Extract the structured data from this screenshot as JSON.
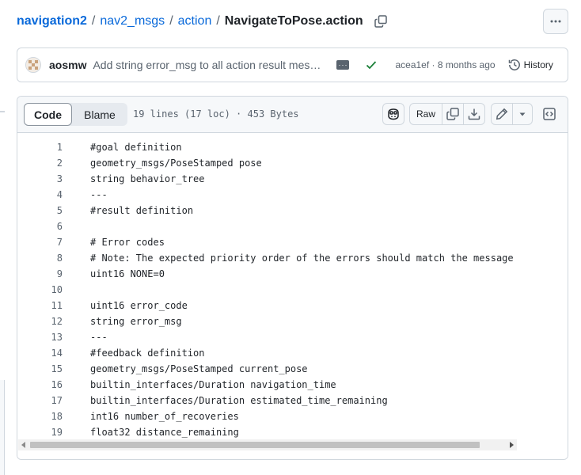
{
  "breadcrumb": {
    "repo": "navigation2",
    "folder1": "nav2_msgs",
    "folder2": "action",
    "file": "NavigateToPose.action",
    "separator": "/"
  },
  "commit": {
    "author": "aosmw",
    "message": "Add string error_msg to all action result messages",
    "sha": "acea1ef",
    "age": "8 months ago",
    "dot": "·",
    "history_label": "History",
    "status": "success",
    "status_color": "#1a7f37"
  },
  "file_header": {
    "code_tab": "Code",
    "blame_tab": "Blame",
    "meta": "19 lines (17 loc) · 453 Bytes",
    "raw_label": "Raw"
  },
  "icons": {
    "copy_path": "copy-icon",
    "more": "kebab-horizontal-icon",
    "history": "history-icon",
    "copilot": "copilot-icon",
    "copy": "copy-icon",
    "download": "download-icon",
    "edit": "pencil-icon",
    "dropdown": "triangle-down-icon",
    "symbols": "code-square-icon"
  },
  "code": {
    "lines": [
      {
        "n": "1",
        "text": "#goal definition"
      },
      {
        "n": "2",
        "text": "geometry_msgs/PoseStamped pose"
      },
      {
        "n": "3",
        "text": "string behavior_tree"
      },
      {
        "n": "4",
        "text": "---"
      },
      {
        "n": "5",
        "text": "#result definition"
      },
      {
        "n": "6",
        "text": ""
      },
      {
        "n": "7",
        "text": "# Error codes"
      },
      {
        "n": "8",
        "text": "# Note: The expected priority order of the errors should match the message"
      },
      {
        "n": "9",
        "text": "uint16 NONE=0"
      },
      {
        "n": "10",
        "text": ""
      },
      {
        "n": "11",
        "text": "uint16 error_code"
      },
      {
        "n": "12",
        "text": "string error_msg"
      },
      {
        "n": "13",
        "text": "---"
      },
      {
        "n": "14",
        "text": "#feedback definition"
      },
      {
        "n": "15",
        "text": "geometry_msgs/PoseStamped current_pose"
      },
      {
        "n": "16",
        "text": "builtin_interfaces/Duration navigation_time"
      },
      {
        "n": "17",
        "text": "builtin_interfaces/Duration estimated_time_remaining"
      },
      {
        "n": "18",
        "text": "int16 number_of_recoveries"
      },
      {
        "n": "19",
        "text": "float32 distance_remaining"
      }
    ]
  },
  "colors": {
    "link": "#0969da",
    "muted": "#59636e",
    "border": "#d0d7de",
    "header_bg": "#f6f8fa"
  }
}
